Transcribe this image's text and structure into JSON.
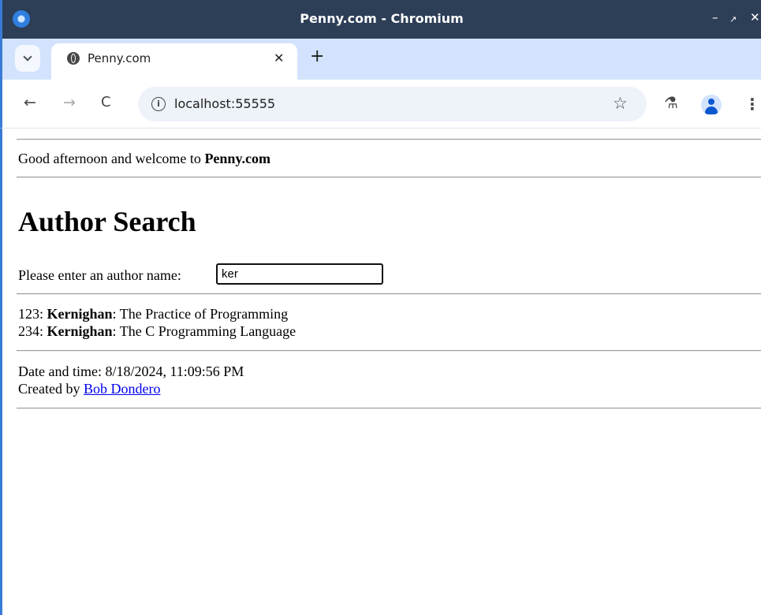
{
  "window": {
    "title": "Penny.com - Chromium",
    "minimize_glyph": "–",
    "maximize_glyph": "↗",
    "close_glyph": "✕"
  },
  "tabs": [
    {
      "title": "Penny.com",
      "active": true,
      "close_glyph": "✕"
    }
  ],
  "tabstrip": {
    "new_tab_glyph": "+"
  },
  "toolbar": {
    "back_glyph": "←",
    "forward_glyph": "→",
    "reload_glyph": "C",
    "url": "localhost:55555",
    "info_glyph": "i",
    "bookmark_glyph": "☆",
    "labs_glyph": "⚗",
    "menu_glyph": "⋮"
  },
  "page": {
    "greeting_prefix": "Good afternoon and welcome to ",
    "greeting_site": "Penny.com",
    "heading": "Author Search",
    "prompt_label": "Please enter an author name:",
    "search_value": "ker",
    "results": [
      {
        "isbn": "123",
        "author": "Kernighan",
        "title": "The Practice of Programming"
      },
      {
        "isbn": "234",
        "author": "Kernighan",
        "title": "The C Programming Language"
      }
    ],
    "datetime_label": "Date and time: 8/18/2024, 11:09:56 PM",
    "created_by_prefix": "Created by ",
    "creator_name": "Bob Dondero"
  },
  "icons": {
    "app": "chromium-icon",
    "tab_favicon": "globe-icon",
    "info": "info-icon",
    "bookmark": "star-icon",
    "labs": "flask-icon",
    "profile": "profile-icon",
    "menu": "kebab-menu-icon"
  },
  "colors": {
    "titlebar_bg": "#2d3e57",
    "tabstrip_bg": "#d3e3fd",
    "omnibox_bg": "#eef2f9",
    "link": "#0000ee",
    "profile_accent": "#0b57d0"
  }
}
